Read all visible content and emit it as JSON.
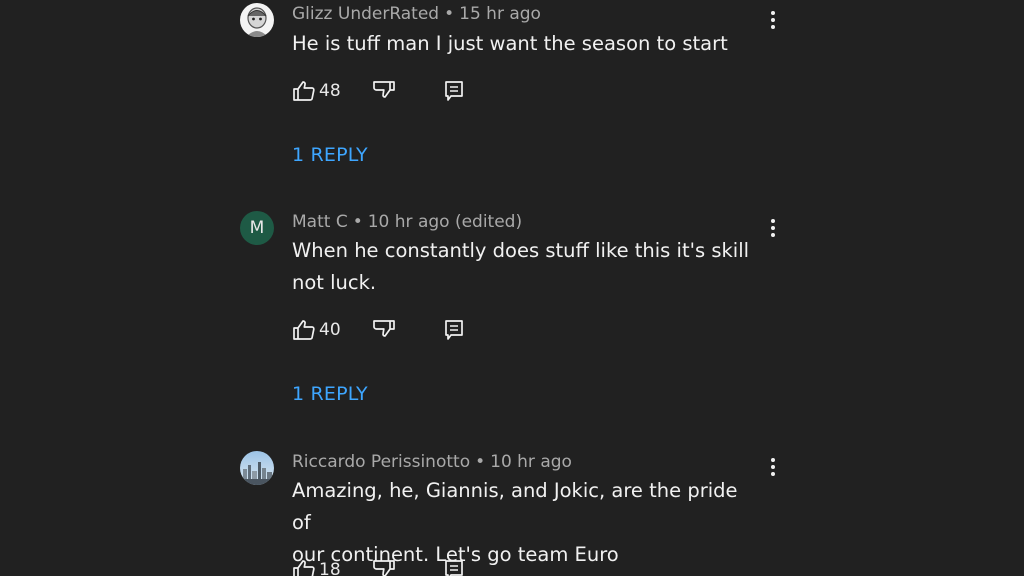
{
  "comments": [
    {
      "author": "Glizz UnderRated",
      "separator": "•",
      "time": "15 hr ago",
      "lines": [
        "He is tuff man I just want the season to start"
      ],
      "likes": "48",
      "replies": "1 REPLY",
      "avatar_icon": "cartoon-avatar-icon"
    },
    {
      "author": "Matt C",
      "separator": "•",
      "time": "10 hr ago (edited)",
      "lines": [
        "When he constantly does stuff like this it's skill",
        "not luck."
      ],
      "likes": "40",
      "replies": "1 REPLY",
      "avatar_letter": "M"
    },
    {
      "author": "Riccardo Perissinotto",
      "separator": "•",
      "time": "10 hr ago",
      "lines": [
        "Amazing, he, Giannis, and Jokic, are the pride of",
        "our continent. Let's go team Euro"
      ],
      "likes": "18",
      "avatar_icon": "city-photo-avatar-icon"
    }
  ],
  "icons": {
    "like": "thumbs-up-icon",
    "dislike": "thumbs-down-icon",
    "reply": "reply-comment-icon",
    "more": "more-vertical-icon"
  },
  "colors": {
    "background": "#212121",
    "reply_link": "#3ea6ff",
    "avatar_m": "#1e5a45"
  }
}
